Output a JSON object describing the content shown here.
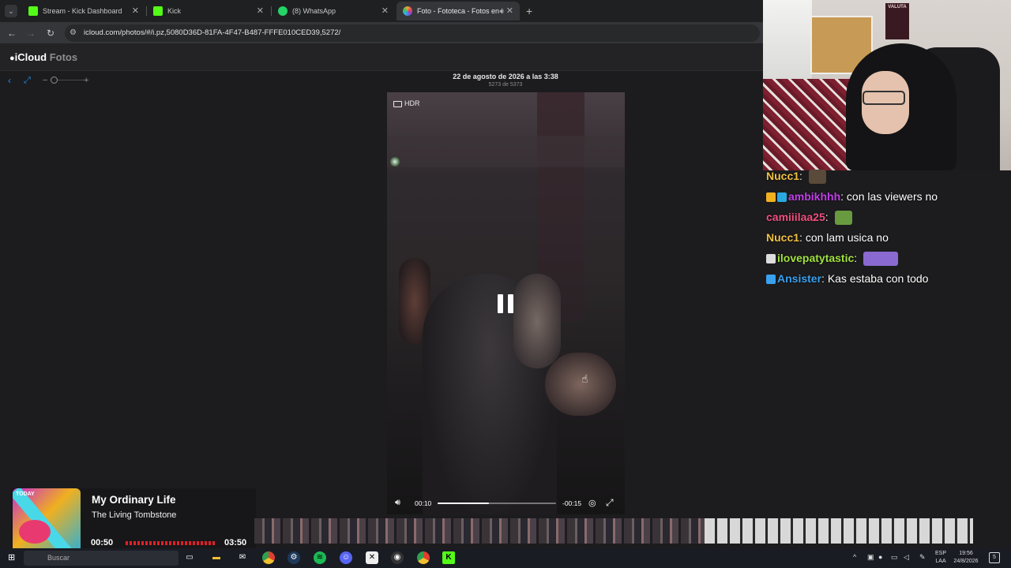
{
  "browser": {
    "tabs": [
      {
        "label": "Stream - Kick Dashboard",
        "favicon_color": "#53fc18"
      },
      {
        "label": "Kick",
        "favicon_color": "#53fc18"
      },
      {
        "label": "(8) WhatsApp",
        "favicon_color": "#25d366"
      },
      {
        "label": "Foto - Fototeca - Fotos en i",
        "favicon_color": "#f0a030",
        "active": true
      }
    ],
    "url": "icloud.com/photos/#/i.pz,5080D36D-81FA-4F47-B487-FFFE010CED39,5272/"
  },
  "icloud": {
    "brand_icloud": "iCloud",
    "brand_fotos": "Fotos"
  },
  "photo": {
    "date": "22 de agosto de 2026 a las 3:38",
    "count": "5273 de 5373",
    "badge": "HDR",
    "time_elapsed": "00:10",
    "time_remaining": "-00:15",
    "progress": 0.43
  },
  "chat": [
    {
      "user": "Nucc1",
      "user_color": "#f0c040",
      "text": "",
      "badges": [],
      "emote": true,
      "emote_color": "#5a4a3a",
      "emote_w": 22
    },
    {
      "user": "ambikhhh",
      "user_color": "#c040e8",
      "text": "con las viewers no",
      "badges": [
        "#f0b020",
        "#2aa8e0"
      ],
      "emote": false
    },
    {
      "user": "camiiilaa25",
      "user_color": "#f05080",
      "text": "",
      "badges": [],
      "emote": true,
      "emote_color": "#6a9a40",
      "emote_w": 22
    },
    {
      "user": "Nucc1",
      "user_color": "#f0c040",
      "text": "con lam usica no",
      "badges": [],
      "emote": false
    },
    {
      "user": "ilovepatytastic",
      "user_color": "#a0e040",
      "text": "",
      "badges": [
        "#dddddd"
      ],
      "emote": true,
      "emote_color": "#8a6ad0",
      "emote_w": 44
    },
    {
      "user": "Ansister",
      "user_color": "#3aa0f0",
      "text": "Kas estaba con todo",
      "badges": [
        "#3aa0f0"
      ],
      "emote": false
    }
  ],
  "webcam": {
    "poster_text": "VALUTA"
  },
  "now_playing": {
    "title": "My Ordinary Life",
    "artist": "The Living Tombstone",
    "elapsed": "00:50",
    "total": "03:50",
    "album_text": "TODAY"
  },
  "taskbar": {
    "search_placeholder": "Buscar",
    "lang_line1": "ESP",
    "lang_line2": "LAA",
    "time": "19:56",
    "date": "24/8/2026",
    "notification_count": "5"
  }
}
